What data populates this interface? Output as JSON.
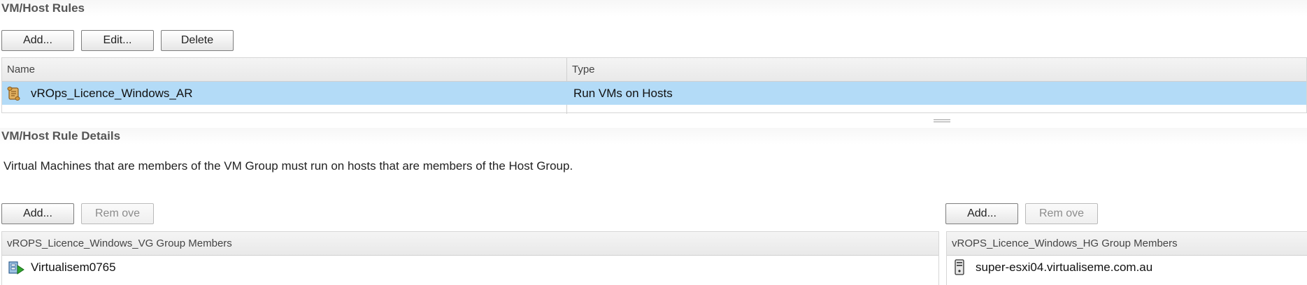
{
  "rules_section": {
    "title": "VM/Host Rules",
    "toolbar": {
      "add_label": "Add...",
      "edit_label": "Edit...",
      "delete_label": "Delete"
    },
    "columns": {
      "name": "Name",
      "type": "Type"
    },
    "rows": [
      {
        "name": "vROps_Licence_Windows_AR",
        "type": "Run VMs on Hosts",
        "icon": "rule-scroll-icon",
        "selected": true
      }
    ]
  },
  "details_section": {
    "title": "VM/Host Rule Details",
    "description": "Virtual Machines that are members of the VM Group must run on hosts that are members of the Host Group.",
    "vm_group": {
      "add_label": "Add...",
      "remove_label": "Rem ove",
      "header": "vROPS_Licence_Windows_VG Group Members",
      "members": [
        {
          "name": "Virtualisem0765",
          "icon": "vm-powered-on-icon"
        }
      ]
    },
    "host_group": {
      "add_label": "Add...",
      "remove_label": "Rem ove",
      "header": "vROPS_Licence_Windows_HG Group Members",
      "members": [
        {
          "name": "super-esxi04.virtualiseme.com.au",
          "icon": "esxi-host-icon"
        }
      ]
    }
  },
  "colors": {
    "selection": "#b3dbf7",
    "header_bg": "#eeeeee",
    "border": "#d6d6d6"
  }
}
